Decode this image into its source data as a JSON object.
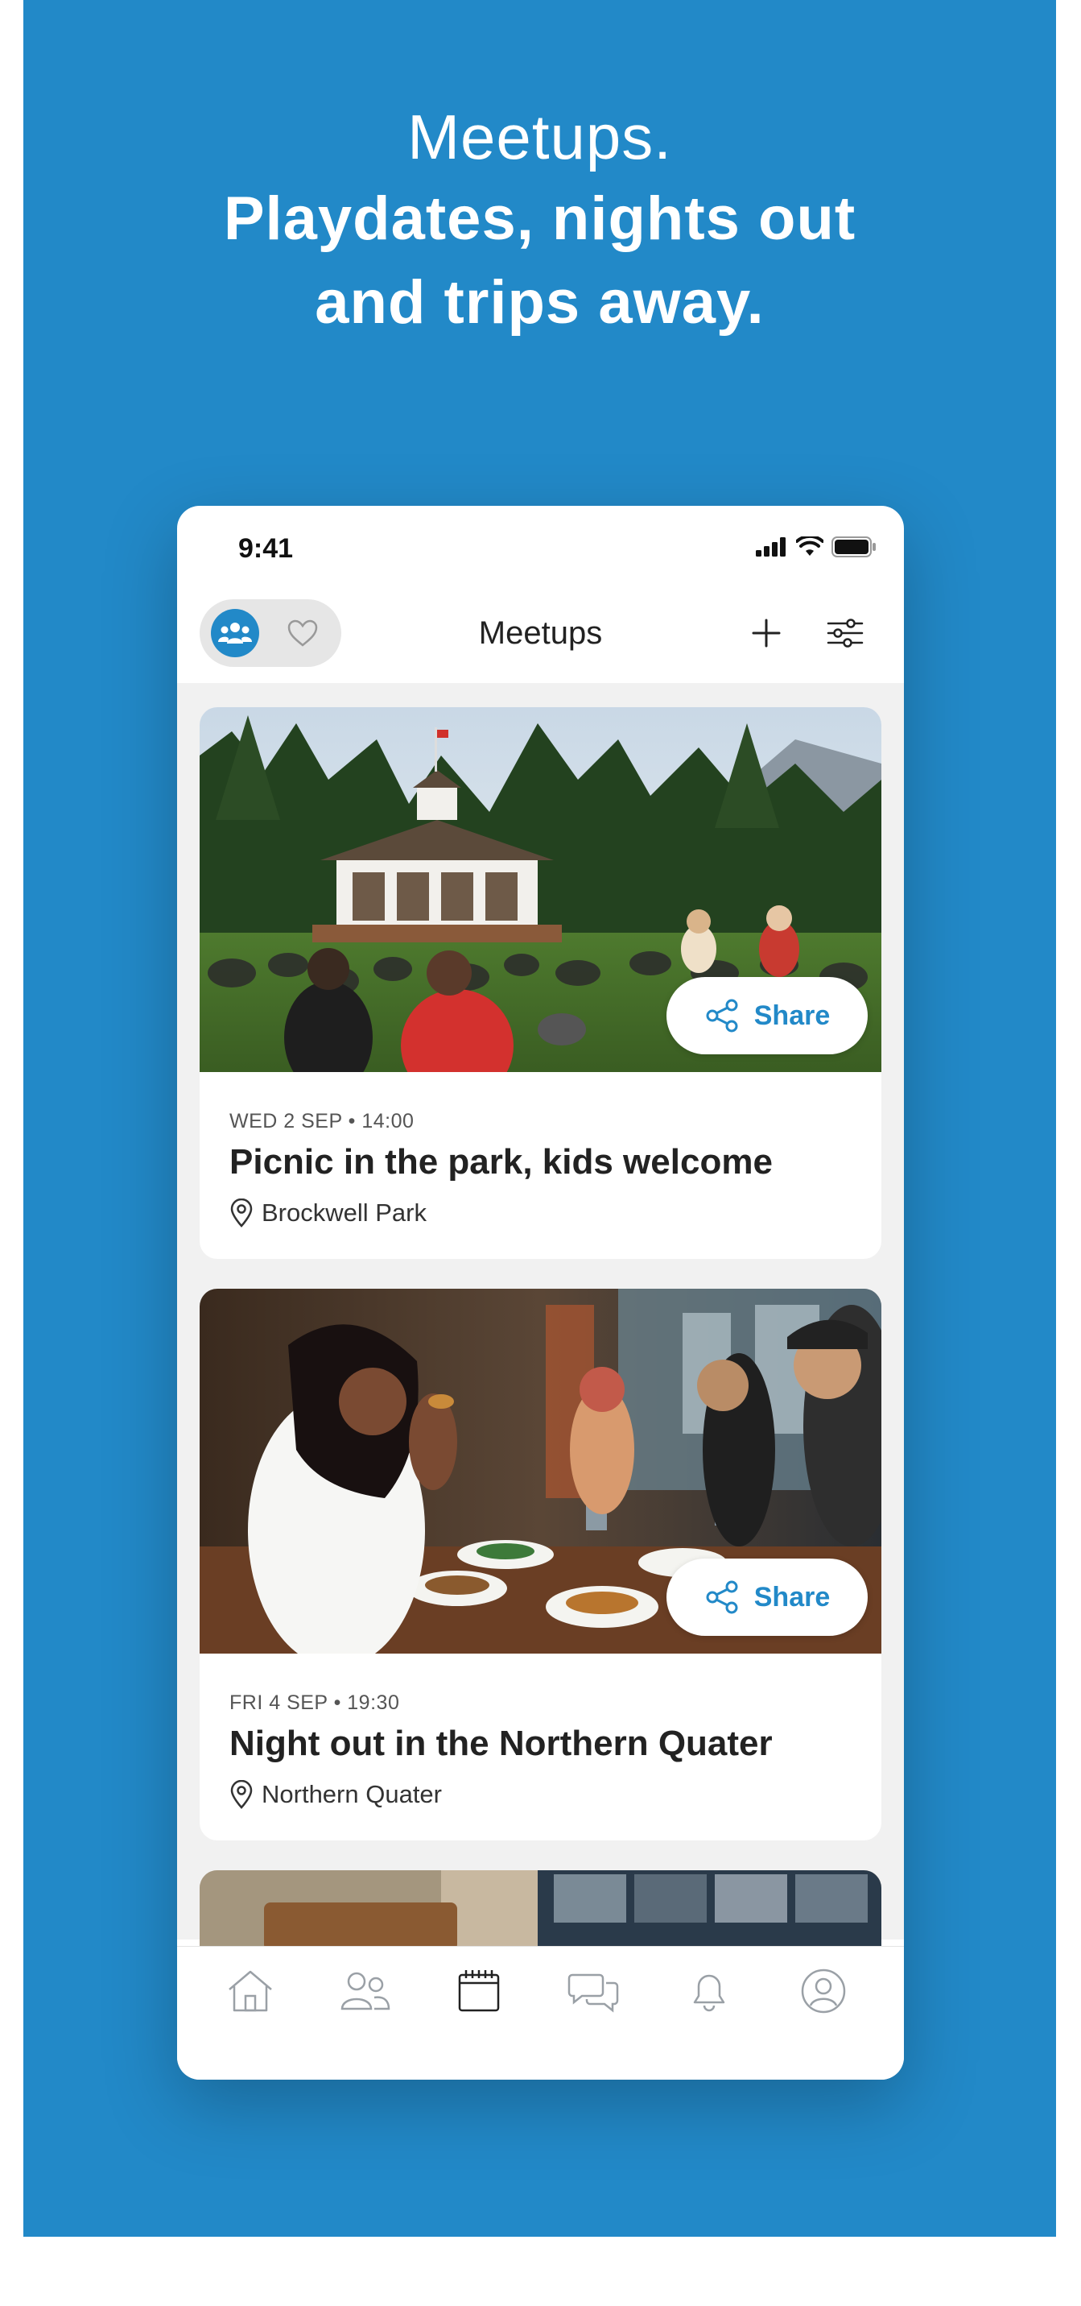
{
  "headline": {
    "line1": "Meetups.",
    "line2a": "Playdates, nights out",
    "line2b": "and trips away."
  },
  "status_bar": {
    "time": "9:41"
  },
  "nav": {
    "title": "Meetups",
    "group_icon": "group-icon",
    "heart_icon": "heart-icon",
    "add_icon": "plus-icon",
    "filter_icon": "sliders-icon"
  },
  "cards": [
    {
      "date": "WED 2 SEP • 14:00",
      "title": "Picnic in the park, kids welcome",
      "location": "Brockwell Park",
      "share_label": "Share"
    },
    {
      "date": "FRI 4 SEP • 19:30",
      "title": "Night out in the Northern Quater",
      "location": "Northern Quater",
      "share_label": "Share"
    }
  ],
  "tabs": [
    "home-icon",
    "people-icon",
    "calendar-icon",
    "chat-icon",
    "bell-icon",
    "profile-icon"
  ],
  "active_tab": "calendar-icon",
  "colors": {
    "brand": "#2289c8",
    "background": "#2289c8",
    "text": "#222222"
  }
}
